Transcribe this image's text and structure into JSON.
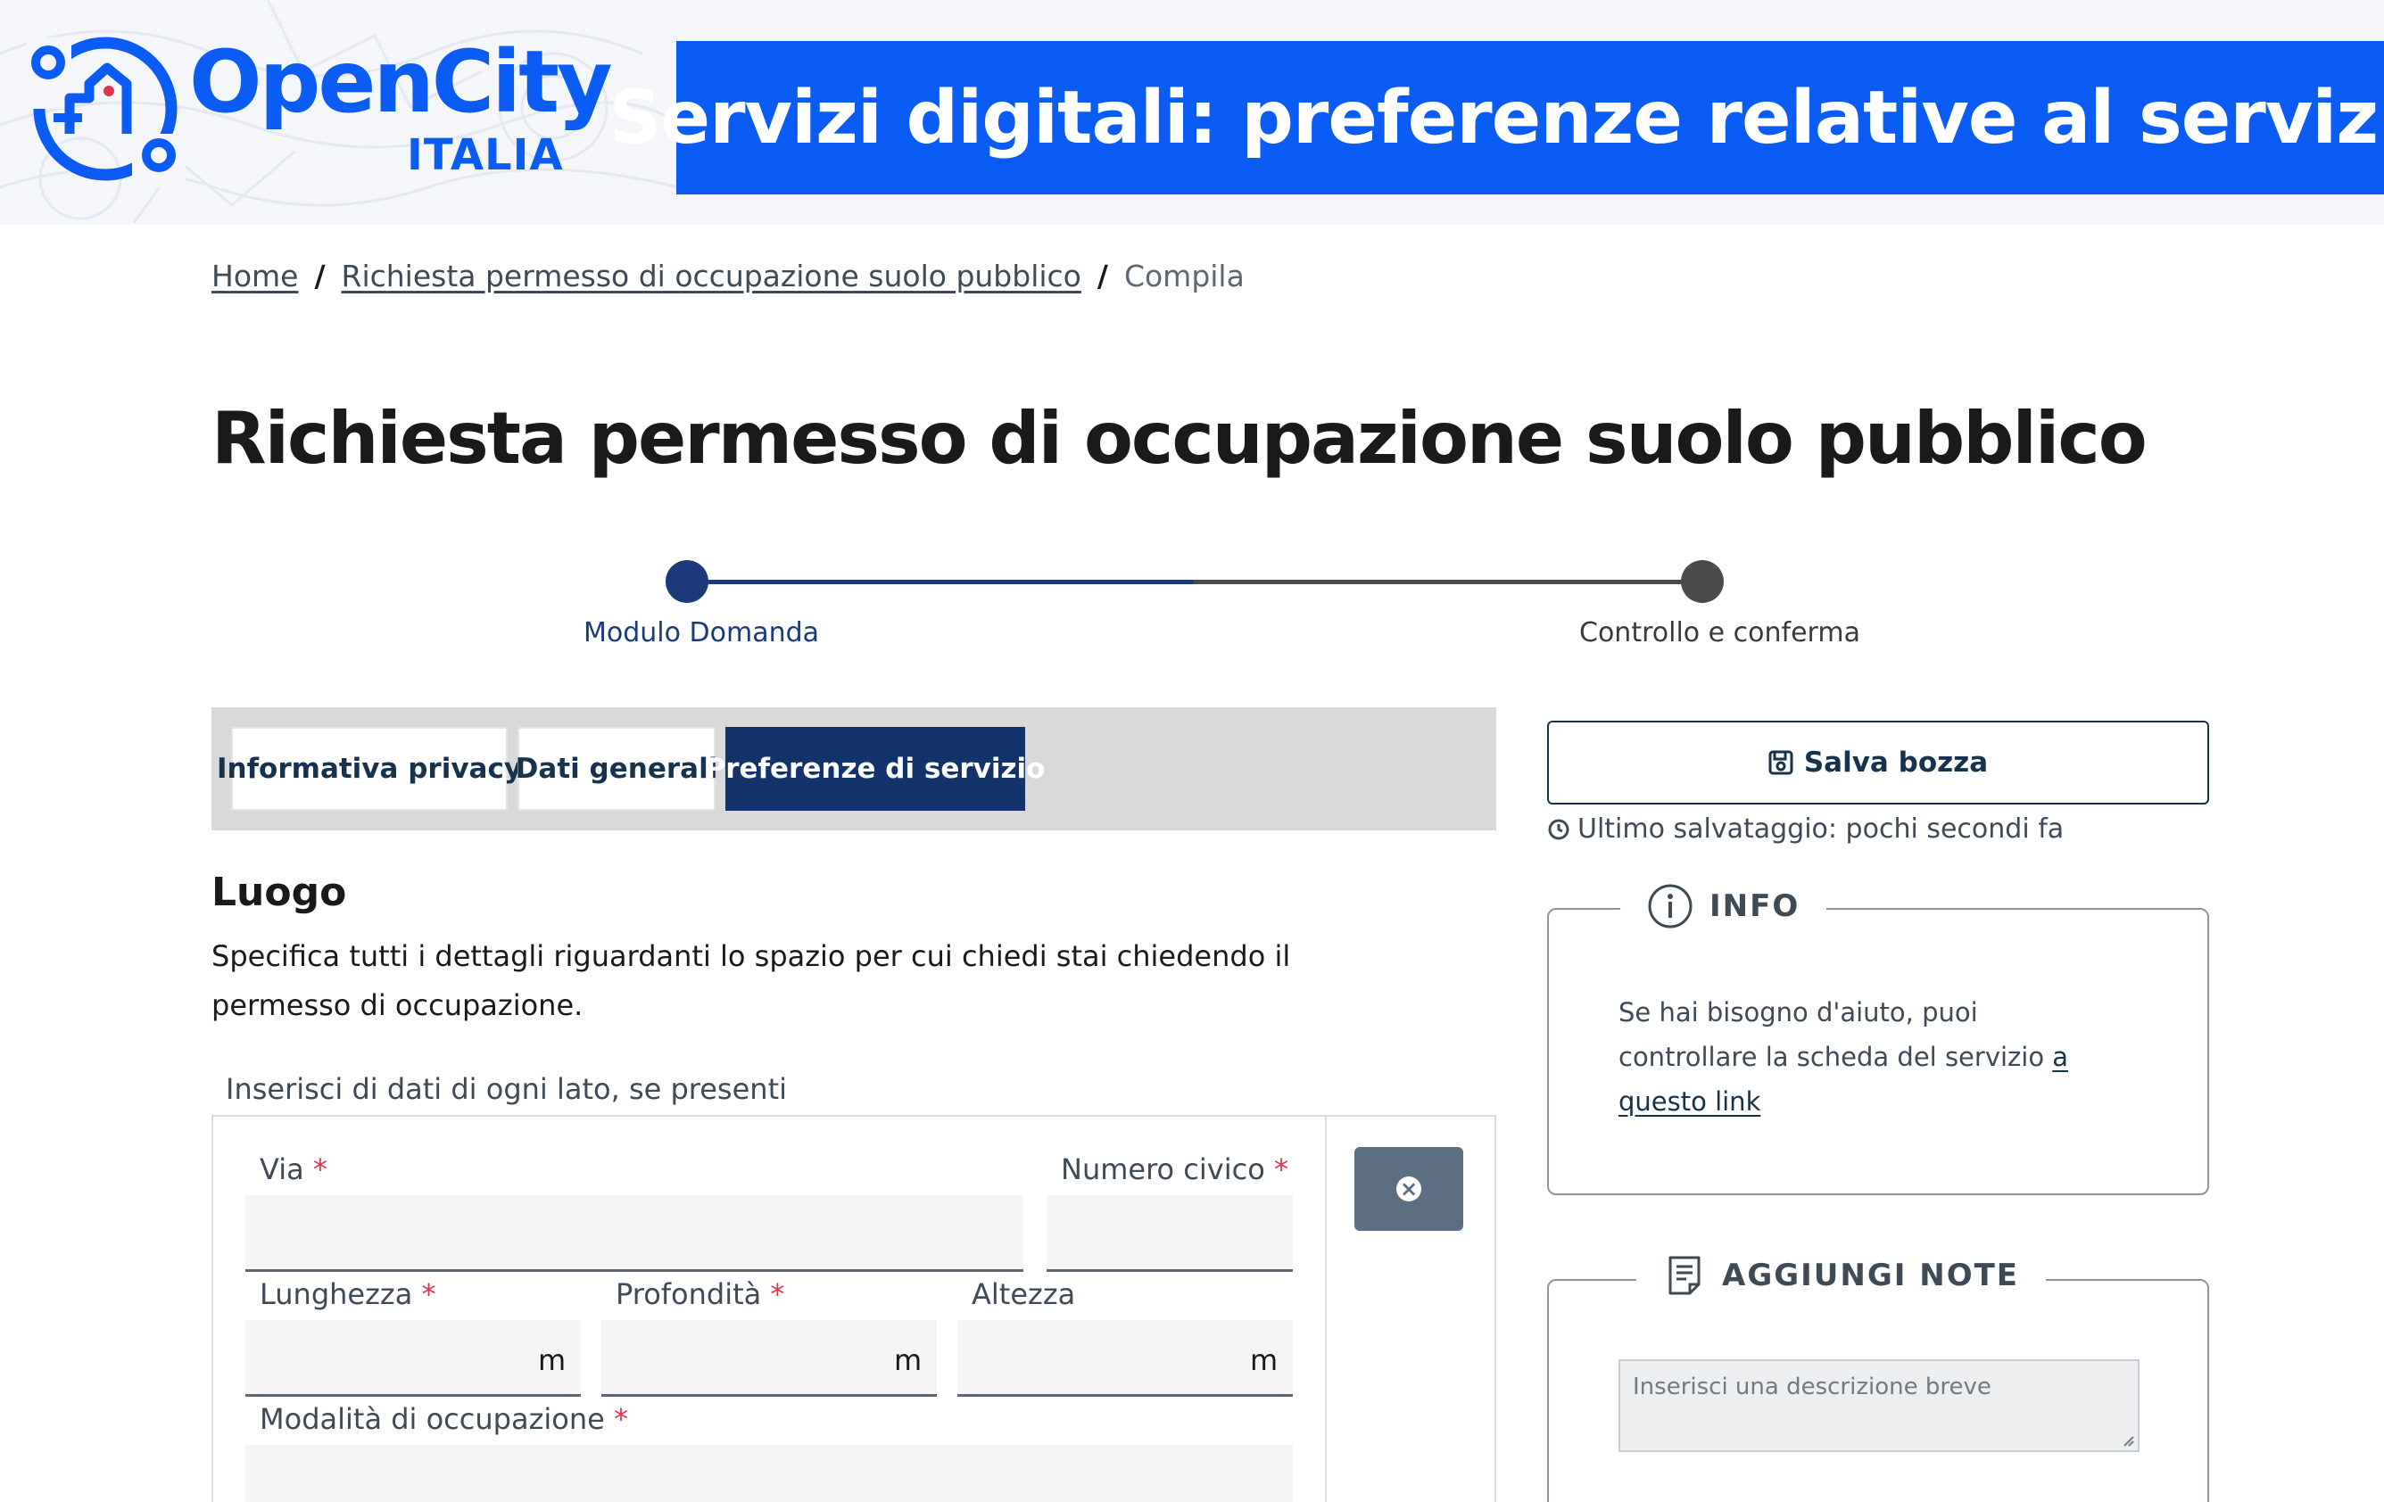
{
  "banner": {
    "logo_text": "OpenCity",
    "logo_sub": "ITALIA",
    "title": "Servizi digitali: preferenze relative al servizio",
    "brand_color": "#0b5cf5"
  },
  "breadcrumb": {
    "home": "Home",
    "service": "Richiesta permesso di occupazione suolo pubblico",
    "current": "Compila",
    "separator": "/"
  },
  "page_title": "Richiesta permesso di occupazione suolo pubblico",
  "stepper": {
    "steps": [
      {
        "label": "Modulo Domanda",
        "state": "current"
      },
      {
        "label": "Controllo e conferma",
        "state": "pending"
      }
    ]
  },
  "tabs": [
    {
      "label": "Informativa privacy",
      "active": false
    },
    {
      "label": "Dati generali",
      "active": false
    },
    {
      "label": "Preferenze di servizio",
      "active": true
    }
  ],
  "section": {
    "title": "Luogo",
    "description": "Specifica tutti i dettagli riguardanti lo spazio per cui chiedi stai chiedendo il permesso di occupazione.",
    "fieldset_legend": "Inserisci di dati di ogni lato, se presenti"
  },
  "fields": {
    "via": {
      "label": "Via",
      "required": "*",
      "value": ""
    },
    "numero_civico": {
      "label": "Numero civico",
      "required": "*",
      "value": ""
    },
    "lunghezza": {
      "label": "Lunghezza",
      "required": "*",
      "unit": "m",
      "value": ""
    },
    "profondita": {
      "label": "Profondità",
      "required": "*",
      "unit": "m",
      "value": ""
    },
    "altezza": {
      "label": "Altezza",
      "unit": "m",
      "value": ""
    },
    "modalita": {
      "label": "Modalità di occupazione",
      "required": "*",
      "value": ""
    }
  },
  "sidebar": {
    "save_label": "Salva bozza",
    "save_status": "Ultimo salvataggio: pochi secondi fa",
    "info": {
      "title": "INFO",
      "text": "Se hai bisogno d'aiuto, puoi controllare la scheda del servizio ",
      "link": "a questo link"
    },
    "notes": {
      "title": "AGGIUNGI NOTE",
      "placeholder": "Inserisci una descrizione breve"
    }
  },
  "icons": {
    "save": "floppy-disk-icon",
    "clock": "clock-icon",
    "info": "info-circle-icon",
    "notes": "note-icon",
    "remove": "close-circle-icon"
  }
}
